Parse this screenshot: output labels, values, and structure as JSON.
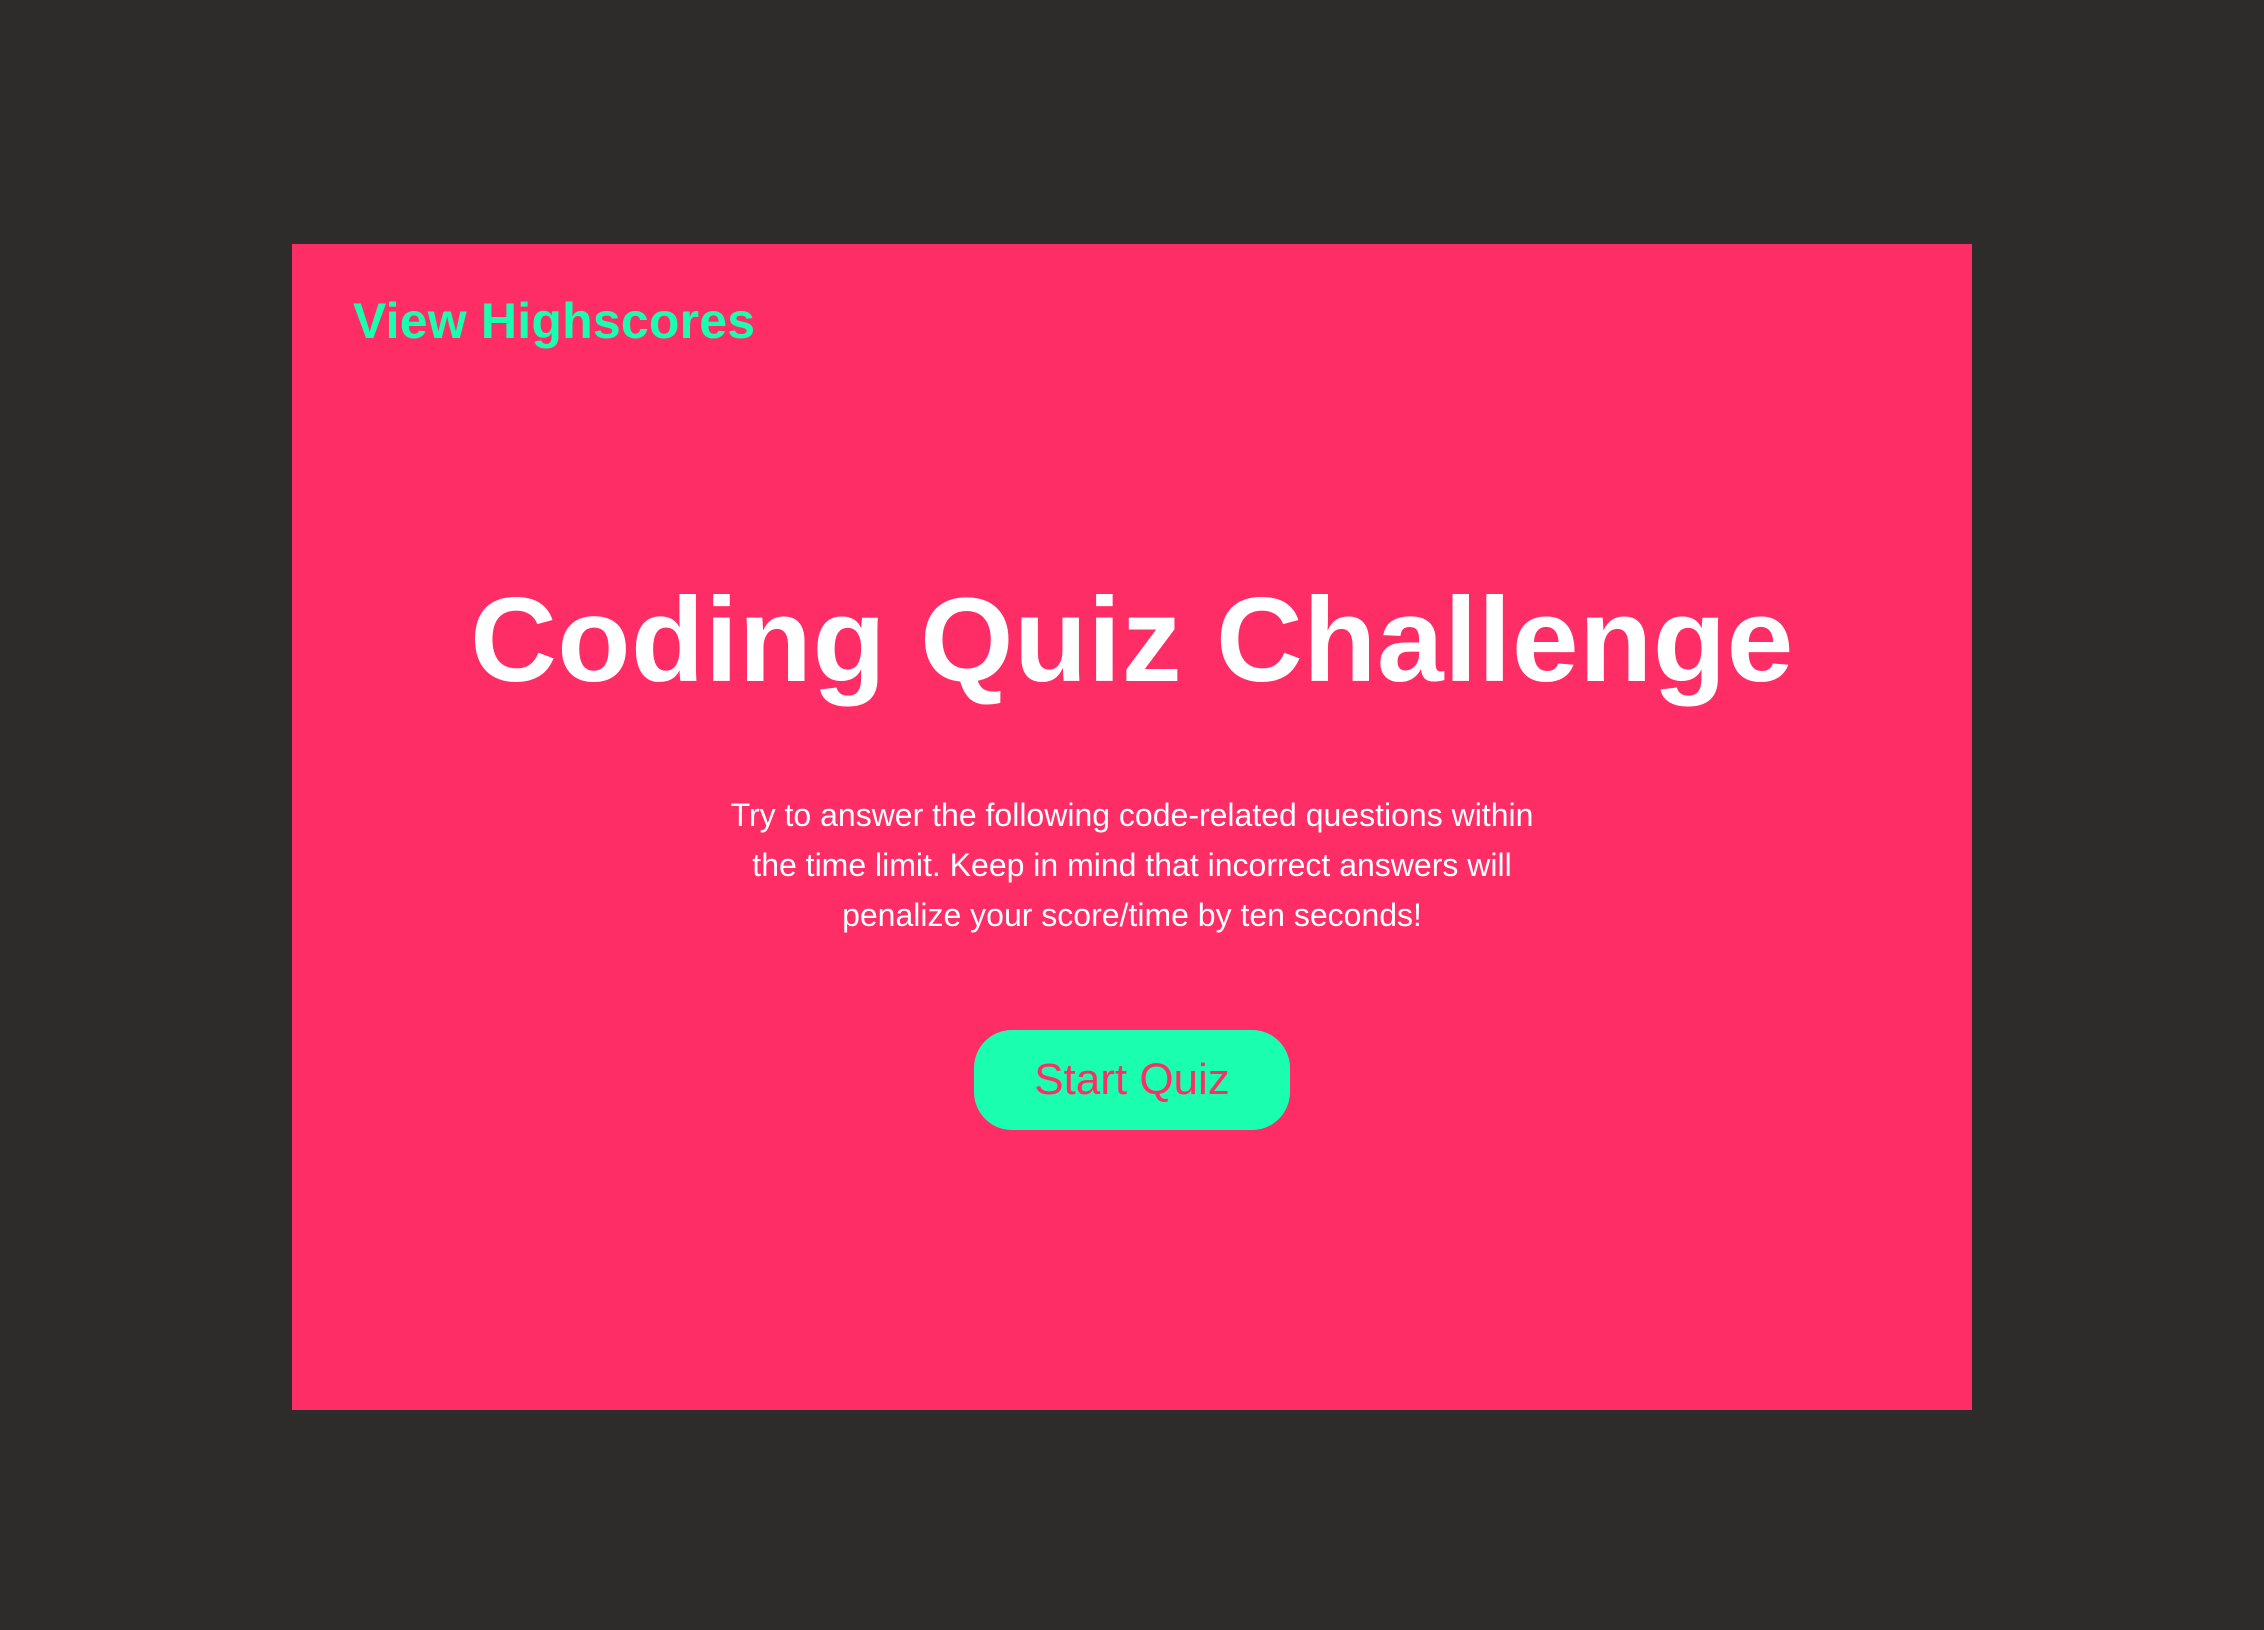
{
  "nav": {
    "highscores_label": "View Highscores"
  },
  "main": {
    "title": "Coding Quiz Challenge",
    "description": "Try to answer the following code-related questions within the time limit. Keep in mind that incorrect answers will penalize your score/time by ten seconds!",
    "start_button_label": "Start Quiz"
  },
  "colors": {
    "page_background": "#2d2c2a",
    "card_background": "#ff2d66",
    "accent": "#1affaf",
    "text": "#ffffff"
  }
}
